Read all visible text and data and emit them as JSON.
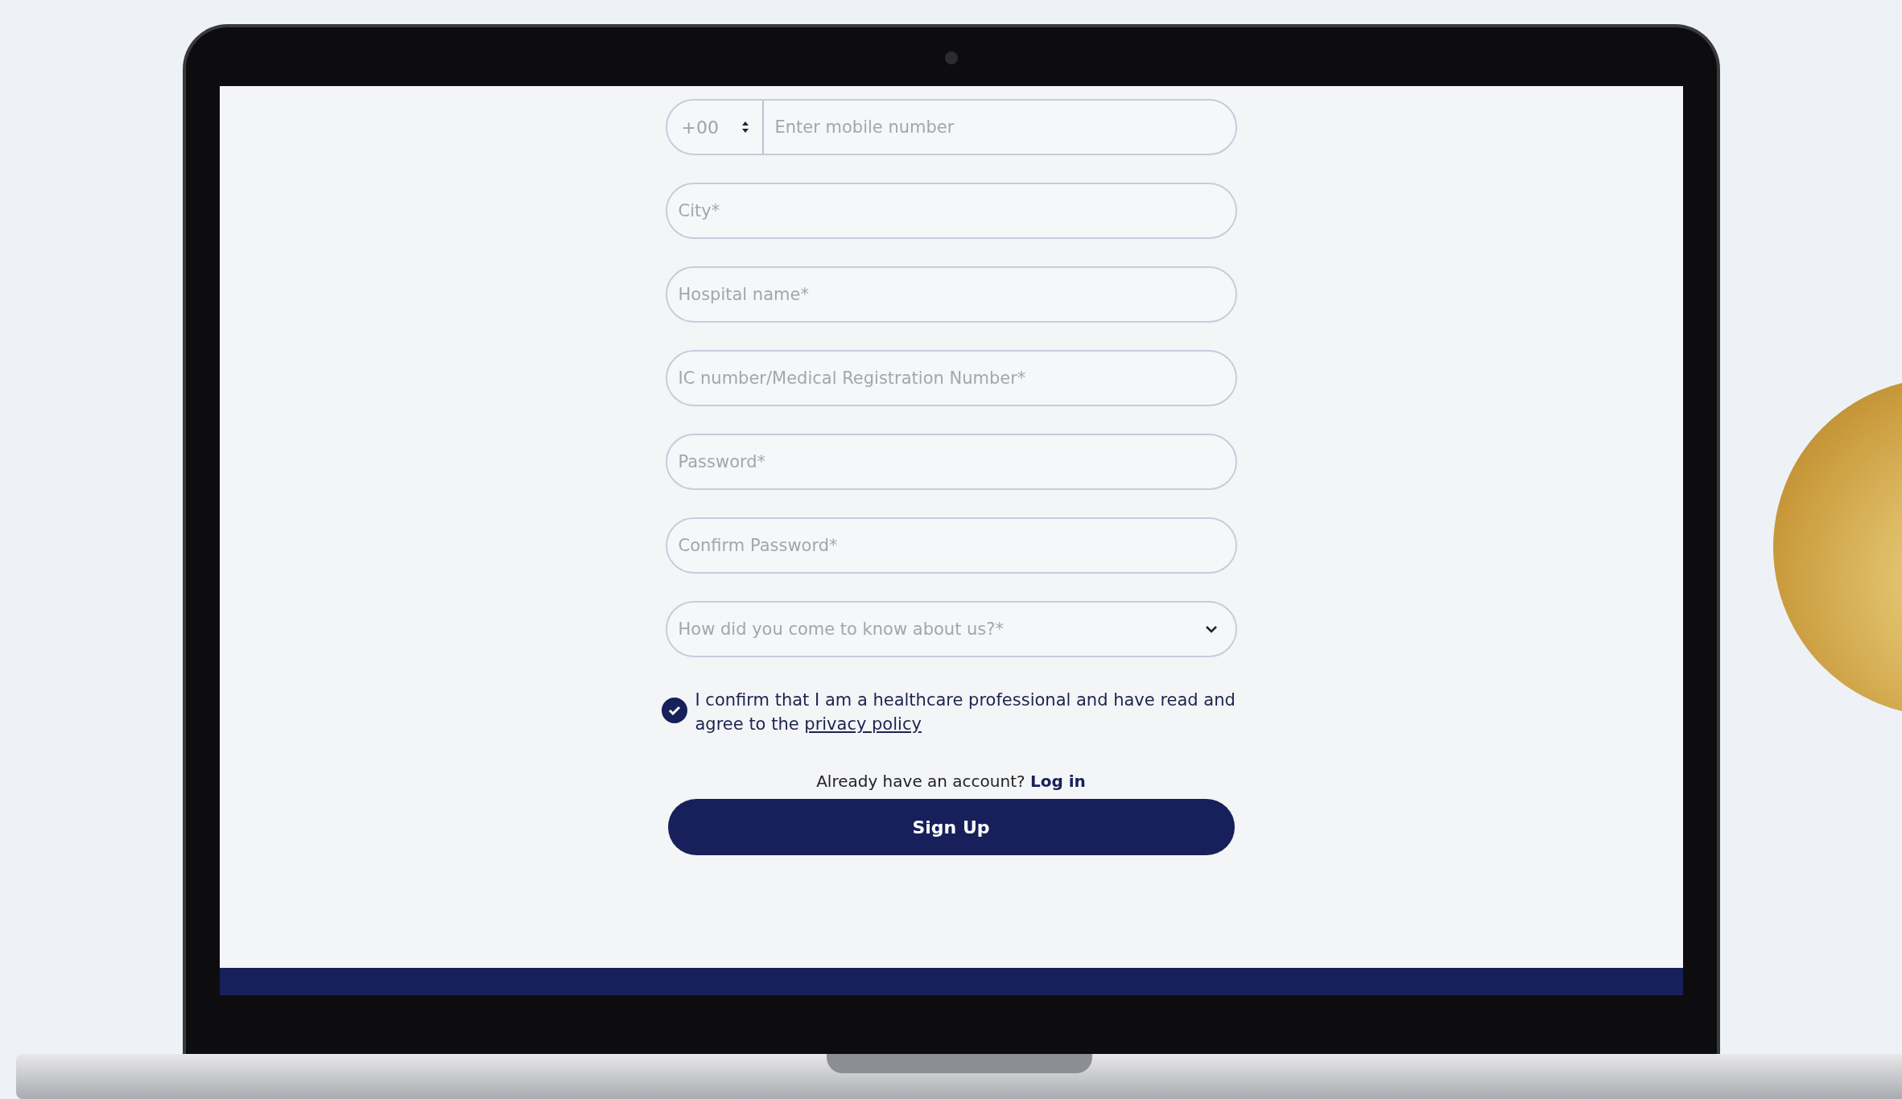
{
  "phone": {
    "code": "+00",
    "placeholder": "Enter mobile number"
  },
  "fields": [
    {
      "placeholder": "City*"
    },
    {
      "placeholder": "Hospital name*"
    },
    {
      "placeholder": "IC number/Medical Registration Number*"
    },
    {
      "placeholder": "Password*"
    },
    {
      "placeholder": "Confirm Password*"
    }
  ],
  "select": {
    "placeholder": "How did you come to know about us?*"
  },
  "consent": {
    "checked": true,
    "text": "I confirm that I am a healthcare professional and have read and agree to the",
    "link": "privacy policy"
  },
  "login_prompt": {
    "text": "Already have an account?",
    "link": "Log in"
  },
  "submit": {
    "label": "Sign Up"
  }
}
